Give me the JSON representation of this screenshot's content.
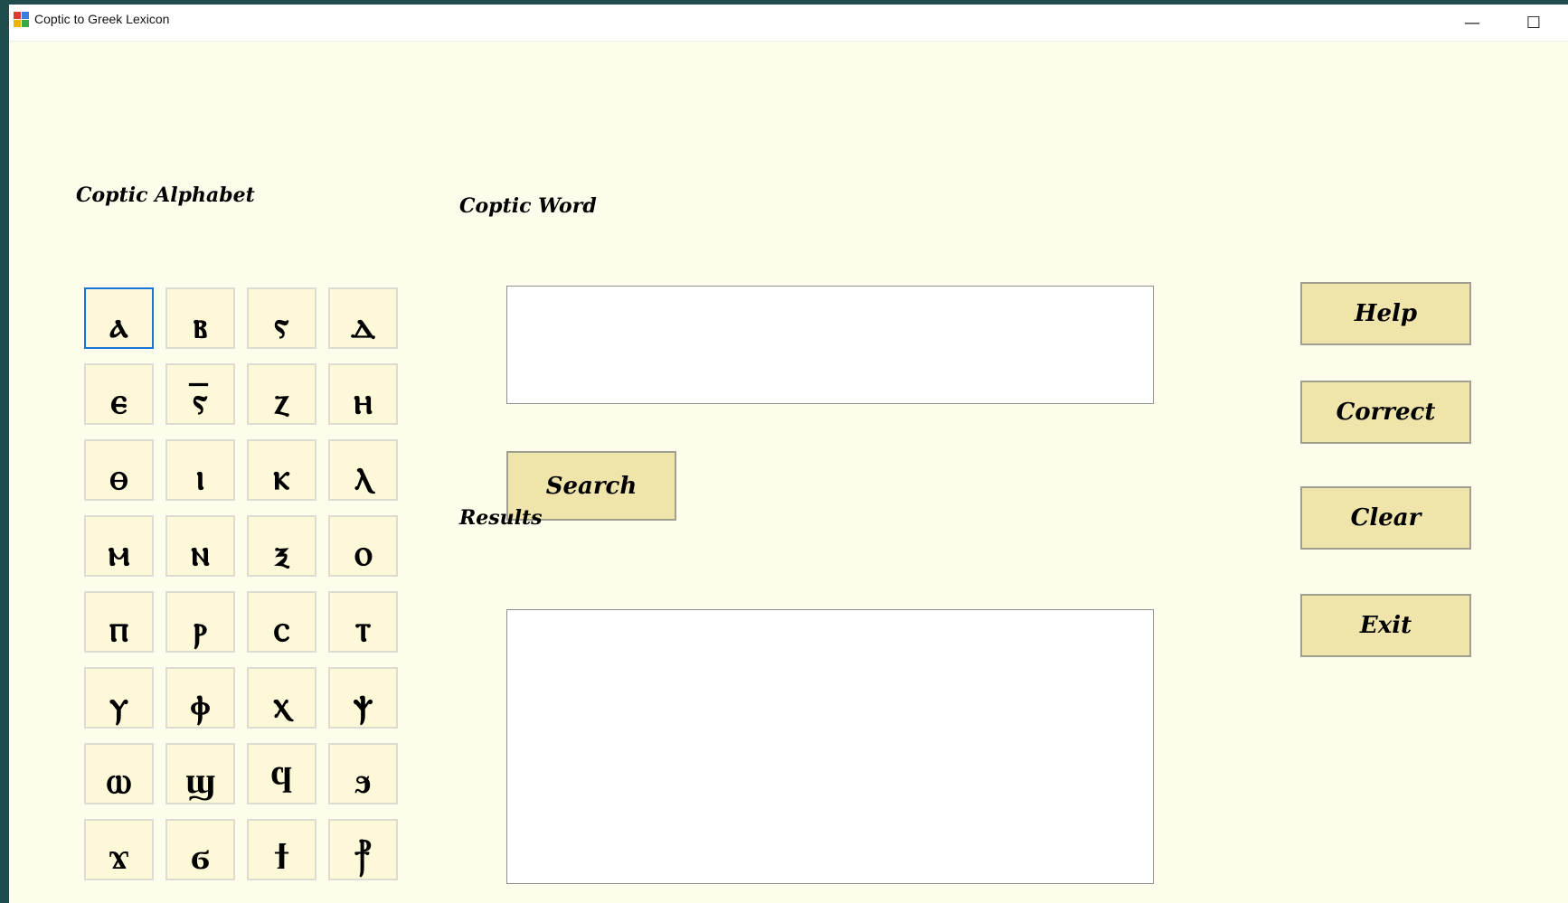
{
  "window": {
    "title": "Coptic to Greek Lexicon",
    "minimize_glyph": "—",
    "maximize_glyph": "☐"
  },
  "alphabet": {
    "label": "Coptic Alphabet",
    "letters": [
      "ⲁ",
      "ⲃ",
      "ⲋ",
      "ⲇ",
      "ⲉ",
      "ⲋ̅",
      "ⲍ",
      "ⲏ",
      "ⲑ",
      "ⲓ",
      "ⲕ",
      "ⲗ",
      "ⲙ",
      "ⲛ",
      "ⲝ",
      "ⲟ",
      "ⲡ",
      "ⲣ",
      "ⲥ",
      "ⲧ",
      "ⲩ",
      "ⲫ",
      "ⲭ",
      "ⲯ",
      "ⲱ",
      "ϣ",
      "ϥ",
      "ϧ",
      "ϫ",
      "ϭ",
      "ϯ",
      "⳨"
    ],
    "selected_index": 0
  },
  "word": {
    "label": "Coptic Word",
    "value": ""
  },
  "search": {
    "label": "Search"
  },
  "results": {
    "label": "Results",
    "value": ""
  },
  "actions": {
    "help": "Help",
    "correct": "Correct",
    "clear": "Clear",
    "exit": "Exit"
  },
  "icons": {
    "app": "app-window-icon"
  }
}
